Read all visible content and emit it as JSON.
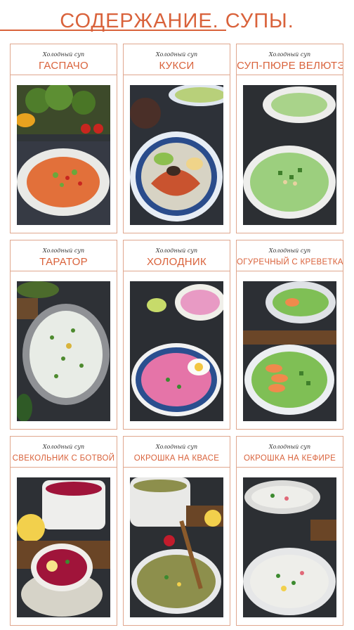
{
  "page": {
    "title": "СОДЕРЖАНИЕ. СУПЫ.",
    "accent_color": "#d9623b",
    "border_color": "#e0a78e"
  },
  "cards": [
    {
      "caption": "Холодный суп",
      "title": "ГАСПАЧО",
      "soup_color": "#e2703a"
    },
    {
      "caption": "Холодный суп",
      "title": "КУКСИ",
      "soup_color": "#c9532f"
    },
    {
      "caption": "Холодный суп",
      "title": "СУП-ПЮРЕ  ВЕЛЮТЭ",
      "soup_color": "#9ccf7e"
    },
    {
      "caption": "Холодный суп",
      "title": "ТАРАТОР",
      "soup_color": "#e8ece6"
    },
    {
      "caption": "Холодный суп",
      "title": "ХОЛОДНИК",
      "soup_color": "#e574a8"
    },
    {
      "caption": "Холодный суп",
      "title": "ОГУРЕЧНЫЙ С КРЕВЕТКАМИ",
      "soup_color": "#7fbf55"
    },
    {
      "caption": "Холодный суп",
      "title": "СВЕКОЛЬНИК С БОТВОЙ",
      "soup_color": "#a0143a"
    },
    {
      "caption": "Холодный суп",
      "title": "ОКРОШКА НА КВАСЕ",
      "soup_color": "#8d8f4c"
    },
    {
      "caption": "Холодный суп",
      "title": "ОКРОШКА НА КЕФИРЕ",
      "soup_color": "#eeeeea"
    }
  ]
}
